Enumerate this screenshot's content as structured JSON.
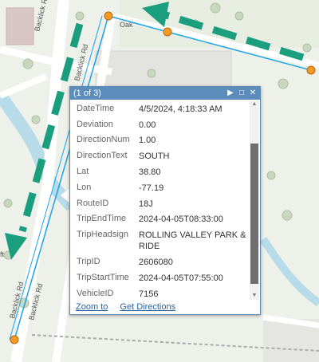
{
  "map": {
    "road_labels": [
      "Backlick Rd",
      "Backlick Rd",
      "Backlick Rd",
      "Backlick Rd"
    ],
    "partial_labels": [
      "Oak",
      "ft"
    ],
    "colors": {
      "route": "#1aa3e8",
      "stop": "#f59a23",
      "arrow": "#1a9e7e",
      "road": "#ffffff",
      "water": "#b7dbe8",
      "park": "#dbe7d3"
    }
  },
  "popup": {
    "title": "(1 of 3)",
    "controls": {
      "next_icon": "play-next-icon",
      "maximize_icon": "maximize-icon",
      "close_icon": "close-icon"
    },
    "fields": [
      {
        "key": "DateTime",
        "value": "4/5/2024, 4:18:33 AM"
      },
      {
        "key": "Deviation",
        "value": "0.00"
      },
      {
        "key": "DirectionNum",
        "value": "1.00"
      },
      {
        "key": "DirectionText",
        "value": "SOUTH"
      },
      {
        "key": "Lat",
        "value": "38.80"
      },
      {
        "key": "Lon",
        "value": "-77.19"
      },
      {
        "key": "RouteID",
        "value": "18J"
      },
      {
        "key": "TripEndTime",
        "value": "2024-04-05T08:33:00"
      },
      {
        "key": "TripHeadsign",
        "value": "ROLLING VALLEY PARK & RIDE"
      },
      {
        "key": "TripID",
        "value": "2606080"
      },
      {
        "key": "TripStartTime",
        "value": "2024-04-05T07:55:00"
      },
      {
        "key": "VehicleID",
        "value": "7156"
      }
    ],
    "links": {
      "zoom_to": "Zoom to",
      "get_directions": "Get Directions"
    }
  }
}
